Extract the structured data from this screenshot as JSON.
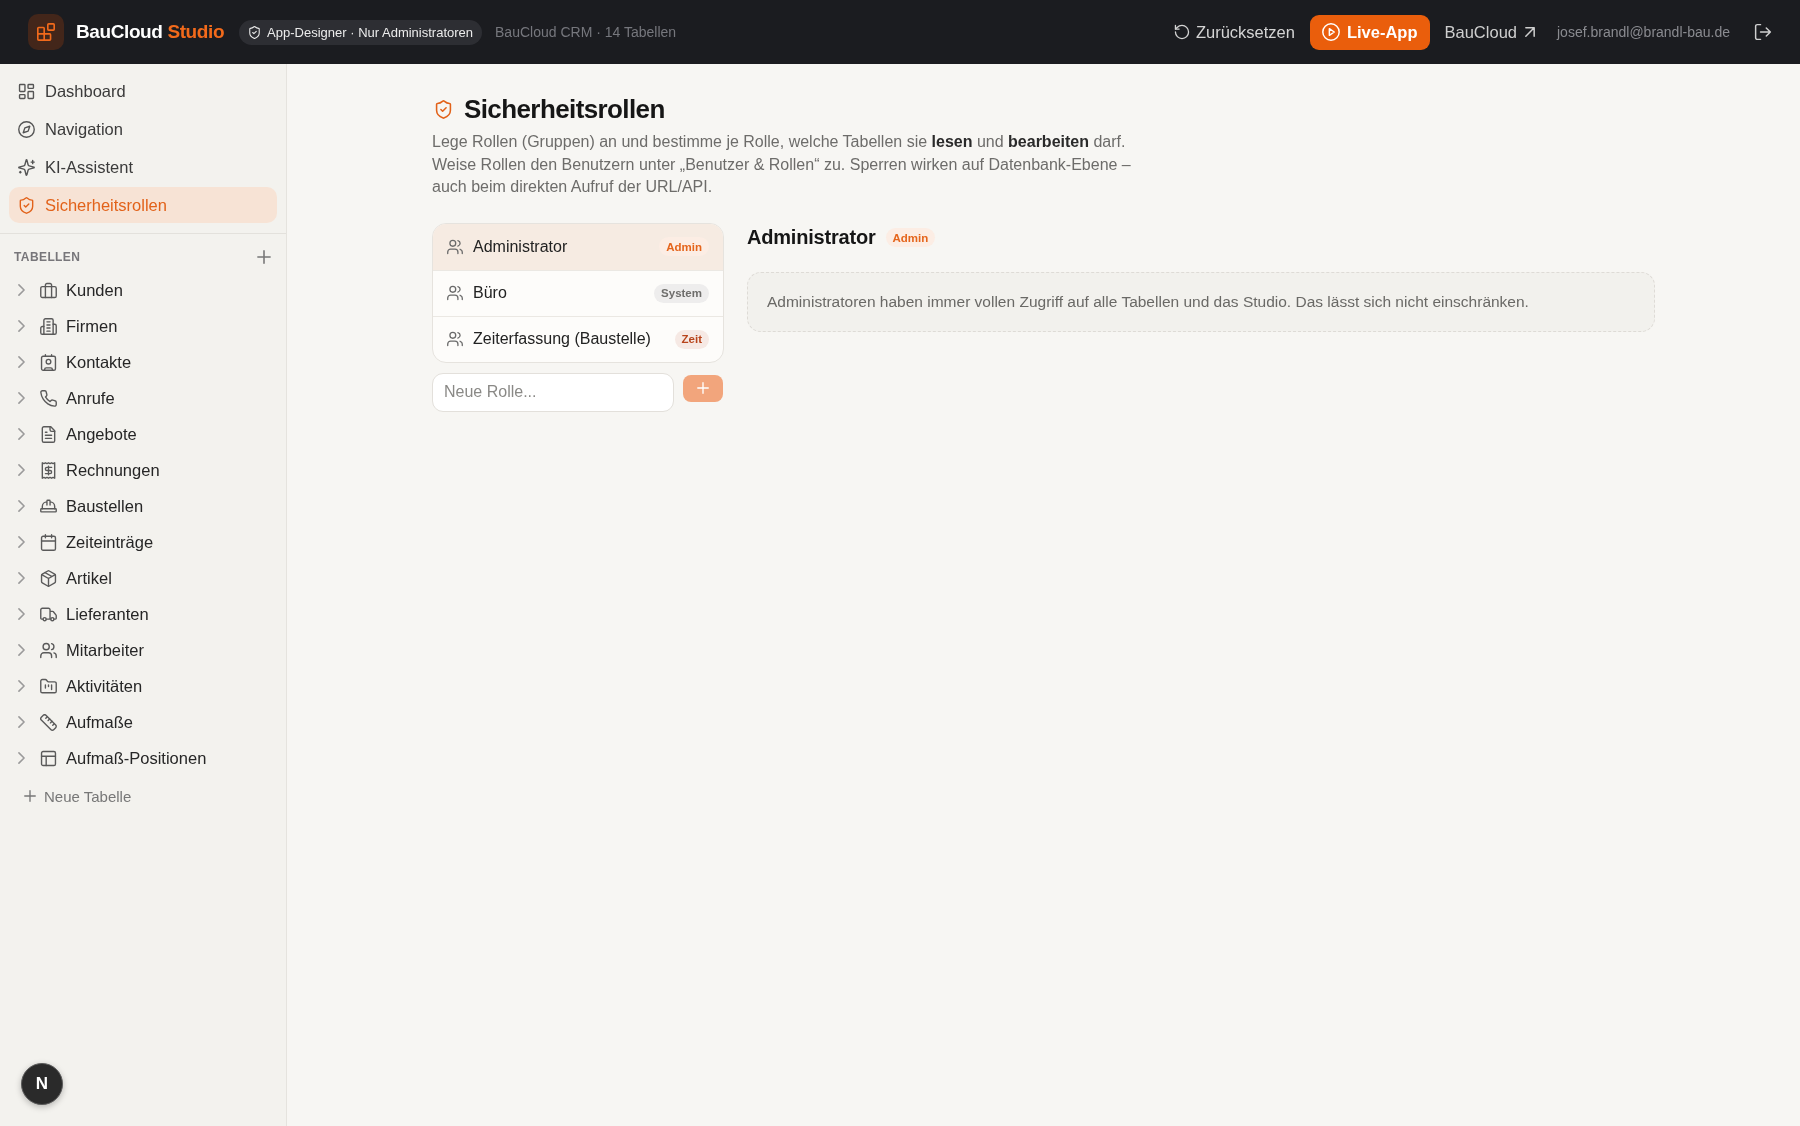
{
  "top_bar": {
    "brand": "BauCloud",
    "brand_accent": "Studio",
    "mode_badge": "App-Designer · Nur Administratoren",
    "project_info": "BauCloud CRM · 14 Tabellen",
    "actions": [
      {
        "kind": "reset",
        "label": "Zurücksetzen"
      },
      {
        "kind": "live",
        "label": "Live-App"
      },
      {
        "kind": "external",
        "label": "BauCloud"
      }
    ],
    "user_email": "josef.brandl@brandl-bau.de"
  },
  "sidebar": {
    "nav_items": [
      {
        "label": "Dashboard",
        "selected": false
      },
      {
        "label": "Navigation",
        "selected": false
      },
      {
        "label": "KI-Assistent",
        "selected": false
      },
      {
        "label": "Sicherheitsrollen",
        "selected": true
      }
    ],
    "tables_heading": "TABELLEN",
    "tables": [
      {
        "label": "Kunden",
        "expanded": false
      },
      {
        "label": "Firmen",
        "expanded": false
      },
      {
        "label": "Kontakte",
        "expanded": false
      },
      {
        "label": "Anrufe",
        "expanded": false
      },
      {
        "label": "Angebote",
        "expanded": false
      },
      {
        "label": "Rechnungen",
        "expanded": false
      },
      {
        "label": "Baustellen",
        "expanded": false
      },
      {
        "label": "Zeiteinträge",
        "expanded": false
      },
      {
        "label": "Artikel",
        "expanded": false
      },
      {
        "label": "Lieferanten",
        "expanded": false
      },
      {
        "label": "Mitarbeiter",
        "expanded": false
      },
      {
        "label": "Aktivitäten",
        "expanded": false
      },
      {
        "label": "Aufmaße",
        "expanded": false
      },
      {
        "label": "Aufmaß-Positionen",
        "expanded": false
      }
    ],
    "new_table": "Neue Tabelle"
  },
  "dev_indicator": {
    "label": "N"
  },
  "page": {
    "title": "Sicherheitsrollen",
    "description": "Lege Rollen (Gruppen) an und bestimme je Rolle, welche Tabellen sie **lesen** und **bearbeiten** darf. Weise Rollen den Benutzern unter „Benutzer & Rollen“ zu. Sperren wirken auf Datenbank-Ebene – auch beim direkten Aufruf der URL/API."
  },
  "roles": [
    {
      "name": "Administrator",
      "badge": {
        "label": "Admin",
        "color": "#e5651c"
      },
      "selected": true
    },
    {
      "name": "Büro",
      "badge": {
        "label": "System",
        "color": "#6e6d6b"
      },
      "selected": false
    },
    {
      "name": "Zeiterfassung (Baustelle)",
      "badge": {
        "label": "Zeit",
        "color": "#b8451c"
      },
      "selected": false
    }
  ],
  "new_role": {
    "placeholder": "Neue Rolle...",
    "add_disabled": true
  },
  "detail": {
    "title": "Administrator",
    "badge": {
      "label": "Admin",
      "color": "#e5651c"
    },
    "notice": "Administratoren haben immer vollen Zugriff auf alle Tabellen und das Studio. Das lässt sich nicht einschränken."
  }
}
